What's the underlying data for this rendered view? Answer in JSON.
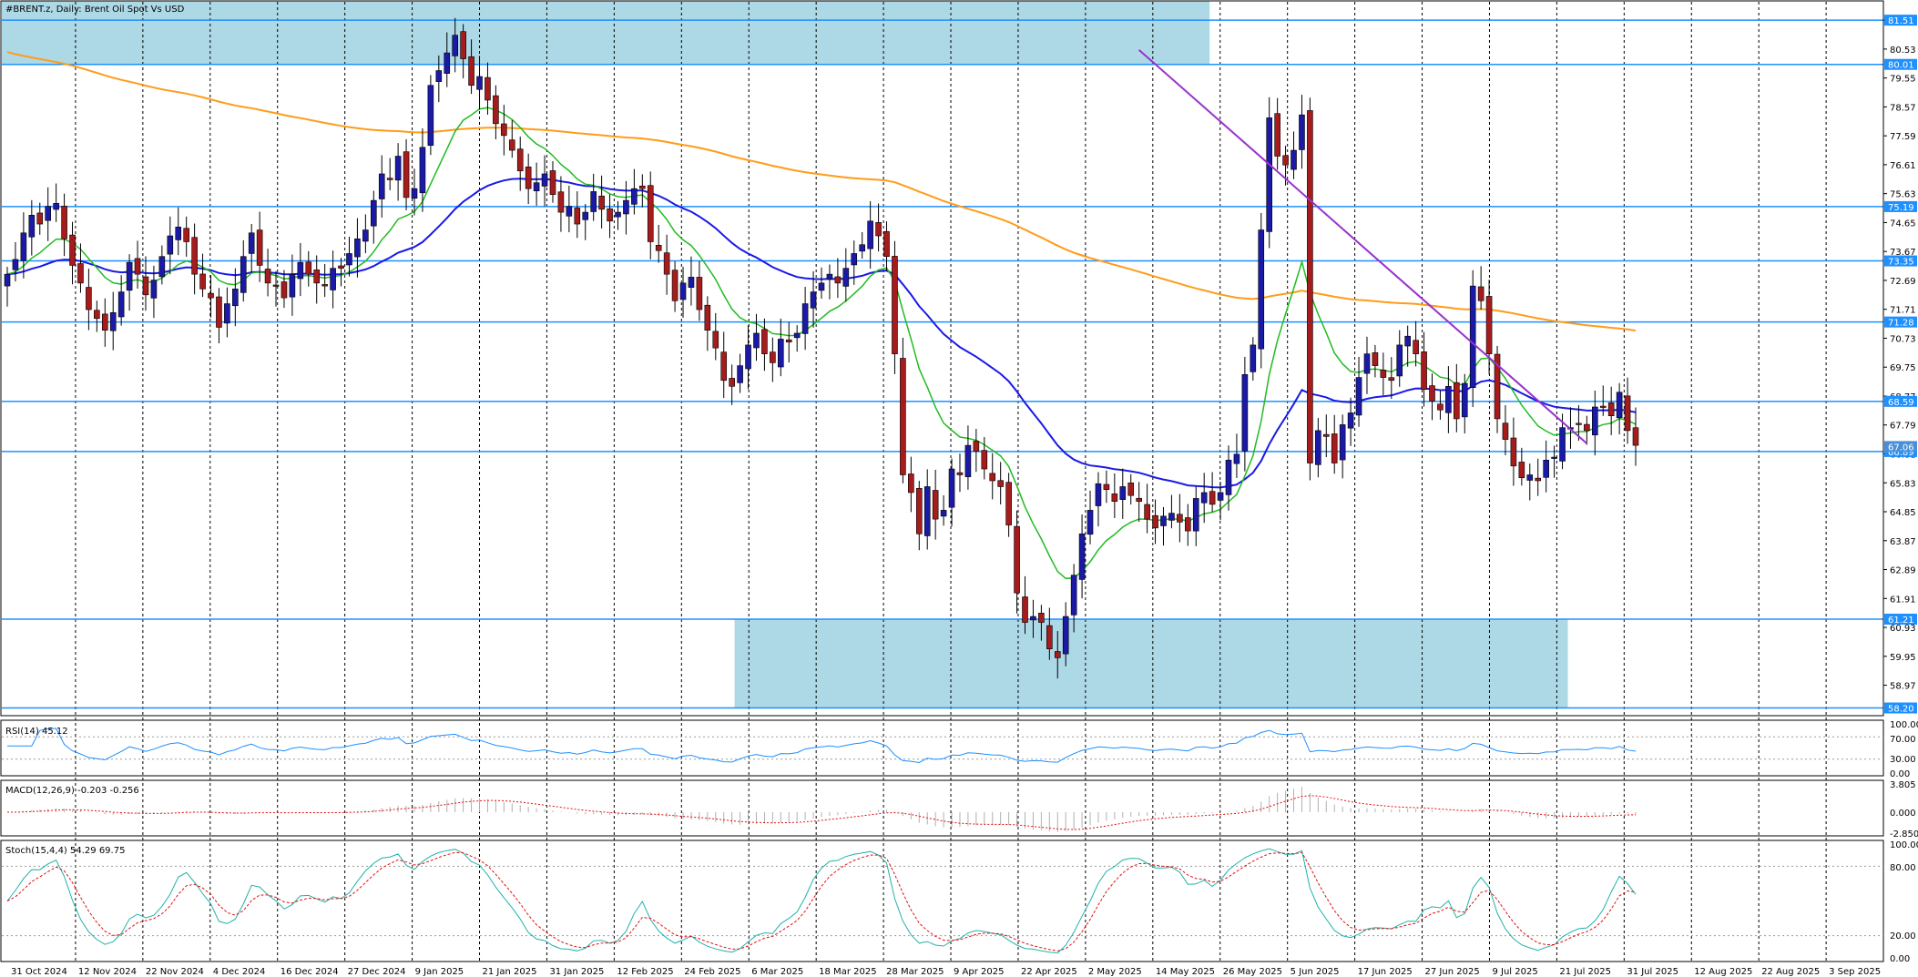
{
  "header": {
    "symbol_title": "#BRENT.z, Daily:  Brent Oil Spot Vs USD"
  },
  "colors": {
    "bull": "#1a1aa6",
    "bear": "#a61c1c",
    "zone": "#add8e6",
    "level_line": "#1e90ff",
    "level_tag": "#1e90ff",
    "ma_short": "#22bb22",
    "ma_mid": "#1a1ae6",
    "ma_long": "#ff9c1a",
    "trendline": "#9932cc",
    "grid": "#000000"
  },
  "price_axis": {
    "min": 58.0,
    "max": 82.1,
    "ticks": [
      "81.51",
      "80.53",
      "79.55",
      "78.57",
      "77.59",
      "76.61",
      "75.63",
      "74.65",
      "73.67",
      "72.69",
      "71.71",
      "70.73",
      "69.75",
      "68.77",
      "67.79",
      "66.81",
      "65.83",
      "64.85",
      "63.87",
      "62.89",
      "61.91",
      "60.93",
      "59.95",
      "58.97"
    ]
  },
  "levels": [
    {
      "value": 81.51,
      "label": "81.51"
    },
    {
      "value": 80.01,
      "label": "80.01"
    },
    {
      "value": 75.19,
      "label": "75.19"
    },
    {
      "value": 73.35,
      "label": "73.35"
    },
    {
      "value": 71.28,
      "label": "71.28"
    },
    {
      "value": 68.59,
      "label": "68.59"
    },
    {
      "value": 66.89,
      "label": "66.89"
    },
    {
      "value": 61.21,
      "label": "61.21"
    },
    {
      "value": 58.2,
      "label": "58.20"
    }
  ],
  "current_price": {
    "value": 67.06,
    "label": "67.06"
  },
  "zones": [
    {
      "from_index": 0,
      "to_index": 147,
      "low": 80.01,
      "high": 82.2
    },
    {
      "from_index": 90,
      "to_index": 191,
      "low": 58.2,
      "high": 61.21
    }
  ],
  "trendline": {
    "from": {
      "index": 139,
      "price": 80.5
    },
    "to": {
      "index": 193,
      "price": 67.1
    }
  },
  "date_labels": [
    "31 Oct 2024",
    "12 Nov 2024",
    "22 Nov 2024",
    "4 Dec 2024",
    "16 Dec 2024",
    "27 Dec 2024",
    "9 Jan 2025",
    "21 Jan 2025",
    "31 Jan 2025",
    "12 Feb 2025",
    "24 Feb 2025",
    "6 Mar 2025",
    "18 Mar 2025",
    "28 Mar 2025",
    "9 Apr 2025",
    "22 Apr 2025",
    "2 May 2025",
    "14 May 2025",
    "26 May 2025",
    "5 Jun 2025",
    "17 Jun 2025",
    "27 Jun 2025",
    "9 Jul 2025",
    "21 Jul 2025",
    "31 Jul 2025",
    "12 Aug 2025",
    "22 Aug 2025",
    "3 Sep 2025"
  ],
  "rsi": {
    "title": "RSI(14) 45.12",
    "ticks": [
      "100.00",
      "70.00",
      "30.00",
      "0.00"
    ]
  },
  "macd": {
    "title": "MACD(12,26,9) -0.203 -0.256",
    "ticks": [
      "3.805",
      "0.000",
      "-2.850"
    ]
  },
  "stoch": {
    "title": "Stoch(15,4,4) 54.29 69.75",
    "ticks": [
      "100.00",
      "80.00",
      "20.00",
      "0.00"
    ]
  },
  "chart_data": {
    "type": "candlestick",
    "title": "#BRENT.z, Daily:  Brent Oil Spot Vs USD",
    "xlabel": "",
    "ylabel": "",
    "ylim": [
      58.0,
      82.1
    ],
    "x_start": "31 Oct 2024",
    "x_end": "4 Sep 2025",
    "series": [
      {
        "name": "",
        "close": [
          72.9,
          73.4,
          74.3,
          74.9,
          74.6,
          75.2,
          75.3,
          74.1,
          73.2,
          72.6,
          71.7,
          71.4,
          71.0,
          71.6,
          72.3,
          73.3,
          72.9,
          72.2,
          72.7,
          73.5,
          74.2,
          74.5,
          74.0,
          72.9,
          72.4,
          72.1,
          71.1,
          71.9,
          72.4,
          73.5,
          74.3,
          73.2,
          72.6,
          72.5,
          72.1,
          72.9,
          73.3,
          72.9,
          72.6,
          72.5,
          73.1,
          73.1,
          73.6,
          74.1,
          74.4,
          75.4,
          76.3,
          76.1,
          76.9,
          75.5,
          75.8,
          77.2,
          79.3,
          79.8,
          80.4,
          81.0,
          80.2,
          79.3,
          79.6,
          78.8,
          78.0,
          77.6,
          77.1,
          76.4,
          75.8,
          76.0,
          76.3,
          75.6,
          75.0,
          75.2,
          74.6,
          75.0,
          75.7,
          75.1,
          74.7,
          75.0,
          75.4,
          75.8,
          75.8,
          74.0,
          73.7,
          72.9,
          72.0,
          72.6,
          72.8,
          71.7,
          71.0,
          70.4,
          69.3,
          69.1,
          69.8,
          70.5,
          70.9,
          70.2,
          69.9,
          70.7,
          70.6,
          70.9,
          71.9,
          72.3,
          72.6,
          72.9,
          72.6,
          73.1,
          73.6,
          73.9,
          74.7,
          74.2,
          73.5,
          70.2,
          66.1,
          65.5,
          64.1,
          65.7,
          64.6,
          64.9,
          66.3,
          66.1,
          67.1,
          66.9,
          66.3,
          65.9,
          65.7,
          64.4,
          62.1,
          61.1,
          61.3,
          61.1,
          60.2,
          59.9,
          61.3,
          62.7,
          64.1,
          64.9,
          65.8,
          65.6,
          65.2,
          65.7,
          65.4,
          65.2,
          64.6,
          64.3,
          64.7,
          64.8,
          64.5,
          64.2,
          65.3,
          65.5,
          65.1,
          65.5,
          66.6,
          66.8,
          69.5,
          70.5,
          74.4,
          78.2,
          76.9,
          76.6,
          77.1,
          78.3,
          66.5,
          67.6,
          67.4,
          66.5,
          67.8,
          68.2,
          69.4,
          70.2,
          69.8,
          69.4,
          69.3,
          70.5,
          70.8,
          70.2,
          69.0,
          68.6,
          68.3,
          69.1,
          68.0,
          69.2,
          72.5,
          72.0,
          70.2,
          68.0,
          67.3,
          66.4,
          66.0,
          66.1,
          65.9,
          66.6,
          66.7,
          67.7,
          67.7,
          67.8,
          67.6,
          68.4,
          68.4,
          68.1,
          68.9,
          67.6,
          67.1
        ]
      }
    ]
  }
}
